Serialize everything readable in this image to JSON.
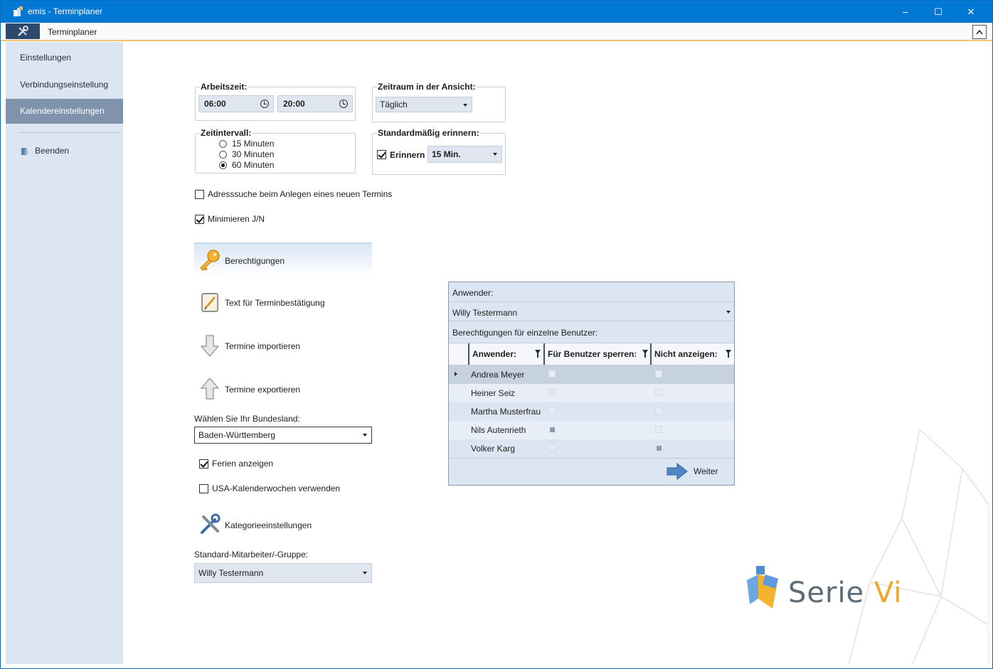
{
  "window": {
    "title": "emis - Terminplaner",
    "minimize_glyph": "–",
    "maximize_glyph": "☐",
    "close_glyph": "✕"
  },
  "ribbon": {
    "tab": "Terminplaner",
    "collapse_glyph": "^"
  },
  "sidebar": {
    "items": [
      {
        "label": "Einstellungen"
      },
      {
        "label": "Verbindungseinstellung"
      },
      {
        "label": "Kalendereinstellungen",
        "active": true
      },
      {
        "label": "Beenden"
      }
    ]
  },
  "arbeitszeit": {
    "title": "Arbeitszeit:",
    "start": "06:00",
    "end": "20:00"
  },
  "zeitraum": {
    "title": "Zeitraum in der Ansicht:",
    "value": "Täglich"
  },
  "zeitintervall": {
    "title": "Zeitintervall:",
    "options": [
      "15 Minuten",
      "30 Minuten",
      "60 Minuten"
    ],
    "selected": "60 Minuten"
  },
  "erinnern": {
    "title": "Standardmäßig erinnern:",
    "checkbox_label": "Erinnern",
    "checked": true,
    "value": "15 Min."
  },
  "options": {
    "adresssuche": {
      "label": "Adresssuche beim Anlegen eines neuen Termins",
      "checked": false
    },
    "minimieren": {
      "label": "Minimieren J/N",
      "checked": true
    }
  },
  "actions": {
    "berechtigungen": "Berechtigungen",
    "text": "Text für Terminbestätigung",
    "import": "Termine importieren",
    "export": "Termine exportieren",
    "kategorie": "Kategorieeinstellungen"
  },
  "bundesland": {
    "label": "Wählen Sie Ihr Bundesland:",
    "value": "Baden-Württemberg"
  },
  "ferien": {
    "label": "Ferien anzeigen",
    "checked": true
  },
  "usa": {
    "label": "USA-Kalenderwochen verwenden",
    "checked": false
  },
  "mitarbeiter": {
    "label": "Standard-Mitarbeiter/-Gruppe:",
    "value": "Willy Testermann"
  },
  "permissions_panel": {
    "anwender_label": "Anwender:",
    "anwender_value": "Willy Testermann",
    "grid_label": "Berechtigungen für einzelne Benutzer:",
    "columns": [
      "Anwender:",
      "Für Benutzer sperren:",
      "Nicht anzeigen:"
    ],
    "rows": [
      {
        "name": "Andrea Meyer",
        "sperren": false,
        "nicht_anzeigen": false,
        "selected": true
      },
      {
        "name": "Heiner Seiz",
        "sperren": false,
        "nicht_anzeigen": false
      },
      {
        "name": "Martha Musterfrau",
        "sperren": false,
        "nicht_anzeigen": false
      },
      {
        "name": "Nils Autenrieth",
        "sperren": true,
        "nicht_anzeigen": false
      },
      {
        "name": "Volker Karg",
        "sperren": false,
        "nicht_anzeigen": true
      }
    ],
    "weiter_label": "Weiter"
  },
  "logo": {
    "text_main": "Serie ",
    "text_accent": "Vi",
    "accent_color": "#f1a62a"
  },
  "colors": {
    "titlebar": "#0078d4",
    "sidebar": "#dce5f2",
    "sidebar_active": "#7f93ad"
  }
}
